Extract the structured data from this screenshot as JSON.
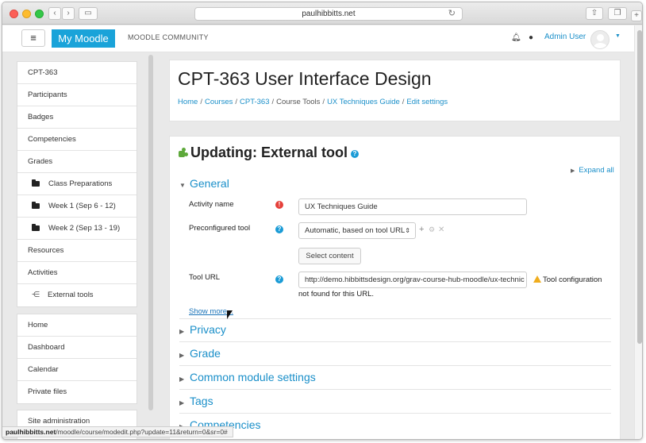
{
  "browser": {
    "address": "paulhibbitts.net",
    "status_url_bold": "paulhibbitts.net",
    "status_url_rest": "/moodle/course/modedit.php?update=11&return=0&sr=0#"
  },
  "navbar": {
    "menu_glyph": "≡",
    "brand": "My Moodle",
    "community": "MOODLE COMMUNITY",
    "user_name": "Admin User"
  },
  "sidebar": {
    "course_nav": [
      {
        "label": "CPT-363"
      },
      {
        "label": "Participants"
      },
      {
        "label": "Badges"
      },
      {
        "label": "Competencies"
      },
      {
        "label": "Grades"
      },
      {
        "label": "Class Preparations",
        "icon": "folder-icon"
      },
      {
        "label": "Week 1 (Sep 6 - 12)",
        "icon": "folder-icon"
      },
      {
        "label": "Week 2 (Sep 13 - 19)",
        "icon": "folder-icon"
      },
      {
        "label": "Resources"
      },
      {
        "label": "Activities"
      },
      {
        "label": "External tools",
        "icon": "external-tool-icon"
      }
    ],
    "site_nav": [
      {
        "label": "Home"
      },
      {
        "label": "Dashboard"
      },
      {
        "label": "Calendar"
      },
      {
        "label": "Private files"
      }
    ],
    "admin_nav": [
      {
        "label": "Site administration"
      }
    ]
  },
  "header": {
    "title": "CPT-363 User Interface Design",
    "breadcrumb": [
      {
        "label": "Home",
        "link": true
      },
      {
        "label": "Courses",
        "link": true
      },
      {
        "label": "CPT-363",
        "link": true
      },
      {
        "label": "Course Tools",
        "link": false
      },
      {
        "label": "UX Techniques Guide",
        "link": true
      },
      {
        "label": "Edit settings",
        "link": true
      }
    ],
    "separator": "/"
  },
  "form": {
    "title": "Updating: External tool",
    "expand_all": "Expand all",
    "general_section": "General",
    "activity_name_label": "Activity name",
    "activity_name_value": "UX Techniques Guide",
    "preconfigured_label": "Preconfigured tool",
    "preconfigured_value": "Automatic, based on tool URL",
    "select_content": "Select content",
    "tool_url_label": "Tool URL",
    "tool_url_value": "http://demo.hibbittsdesign.org/grav-course-hub-moodle/ux-technic",
    "warning_line1": "Tool configuration",
    "warning_line2": "not found for this URL.",
    "show_more": "Show more...",
    "collapsed_sections": [
      "Privacy",
      "Grade",
      "Common module settings",
      "Tags",
      "Competencies"
    ]
  },
  "colors": {
    "brand": "#1aa3d9",
    "link": "#1a8fc9",
    "required": "#e5403a",
    "warning": "#f0ad1e"
  }
}
